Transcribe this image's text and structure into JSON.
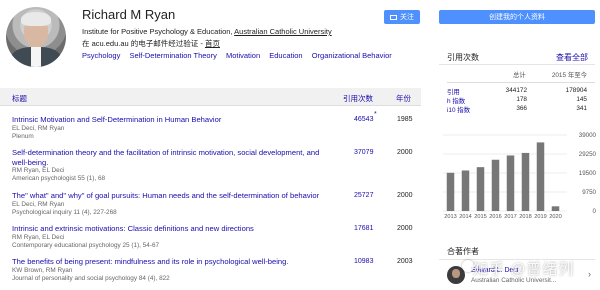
{
  "profile": {
    "name": "Richard M Ryan",
    "affiliation_prefix": "Institute for Positive Psychology & Education, ",
    "affiliation_link": "Australian Catholic University",
    "email_text": "在 acu.edu.au 的电子邮件经过验证 - ",
    "homepage_link": "首页",
    "tags": [
      "Psychology",
      "Self-Determination Theory",
      "Motivation",
      "Education",
      "Organizational Behavior"
    ]
  },
  "buttons": {
    "follow": "关注",
    "create_profile": "创建我的个人资料"
  },
  "table": {
    "col_title": "标题",
    "col_cited": "引用次数",
    "col_year": "年份",
    "rows": [
      {
        "title": "Intrinsic Motivation and Self-Determination in Human Behavior",
        "authors": "EL Deci, RM Ryan",
        "venue": "Plenum",
        "cited": "46543",
        "star": "*",
        "year": "1985"
      },
      {
        "title": "Self-determination theory and the facilitation of intrinsic motivation, social development, and well-being.",
        "authors": "RM Ryan, EL Deci",
        "venue": "American psychologist 55 (1), 68",
        "cited": "37079",
        "star": "",
        "year": "2000"
      },
      {
        "title": "The\" what\" and\" why\" of goal pursuits: Human needs and the self-determination of behavior",
        "authors": "EL Deci, RM Ryan",
        "venue": "Psychological inquiry 11 (4), 227-268",
        "cited": "25727",
        "star": "",
        "year": "2000"
      },
      {
        "title": "Intrinsic and extrinsic motivations: Classic definitions and new directions",
        "authors": "RM Ryan, EL Deci",
        "venue": "Contemporary educational psychology 25 (1), 54-67",
        "cited": "17681",
        "star": "",
        "year": "2000"
      },
      {
        "title": "The benefits of being present: mindfulness and its role in psychological well-being.",
        "authors": "KW Brown, RM Ryan",
        "venue": "Journal of personality and social psychology 84 (4), 822",
        "cited": "10983",
        "star": "",
        "year": "2003"
      }
    ]
  },
  "sidebar": {
    "cited_heading": "引用次数",
    "view_all": "查看全部",
    "stats_header_total": "总计",
    "stats_header_since": "2015 年至今",
    "stats": [
      {
        "label": "引用",
        "total": "344172",
        "since": "178904"
      },
      {
        "label": "h 指数",
        "total": "178",
        "since": "145"
      },
      {
        "label": "i10 指数",
        "total": "366",
        "since": "341"
      }
    ],
    "coauthors_heading": "合著作者",
    "coauthor": {
      "name": "Edward L. Deci",
      "institution": "Australian Catholic Universit..."
    }
  },
  "chart_data": {
    "type": "bar",
    "title": "",
    "xlabel": "",
    "ylabel": "",
    "categories": [
      "2013",
      "2014",
      "2015",
      "2016",
      "2017",
      "2018",
      "2019",
      "2020"
    ],
    "values": [
      19600,
      20800,
      22500,
      26300,
      28500,
      29800,
      35200,
      2400
    ],
    "ylim": [
      0,
      39000
    ],
    "yticks": [
      "39000",
      "29250",
      "19500",
      "9750",
      "0"
    ],
    "ytick_values": [
      39000,
      29250,
      19500,
      9750,
      0
    ],
    "bar_color": "#777777",
    "grid": true
  },
  "watermark": {
    "text": "知乎 @普绪列"
  },
  "colors": {
    "link": "#1a0dab",
    "button": "#4d90fe",
    "header_bg": "#f1f1f1"
  }
}
